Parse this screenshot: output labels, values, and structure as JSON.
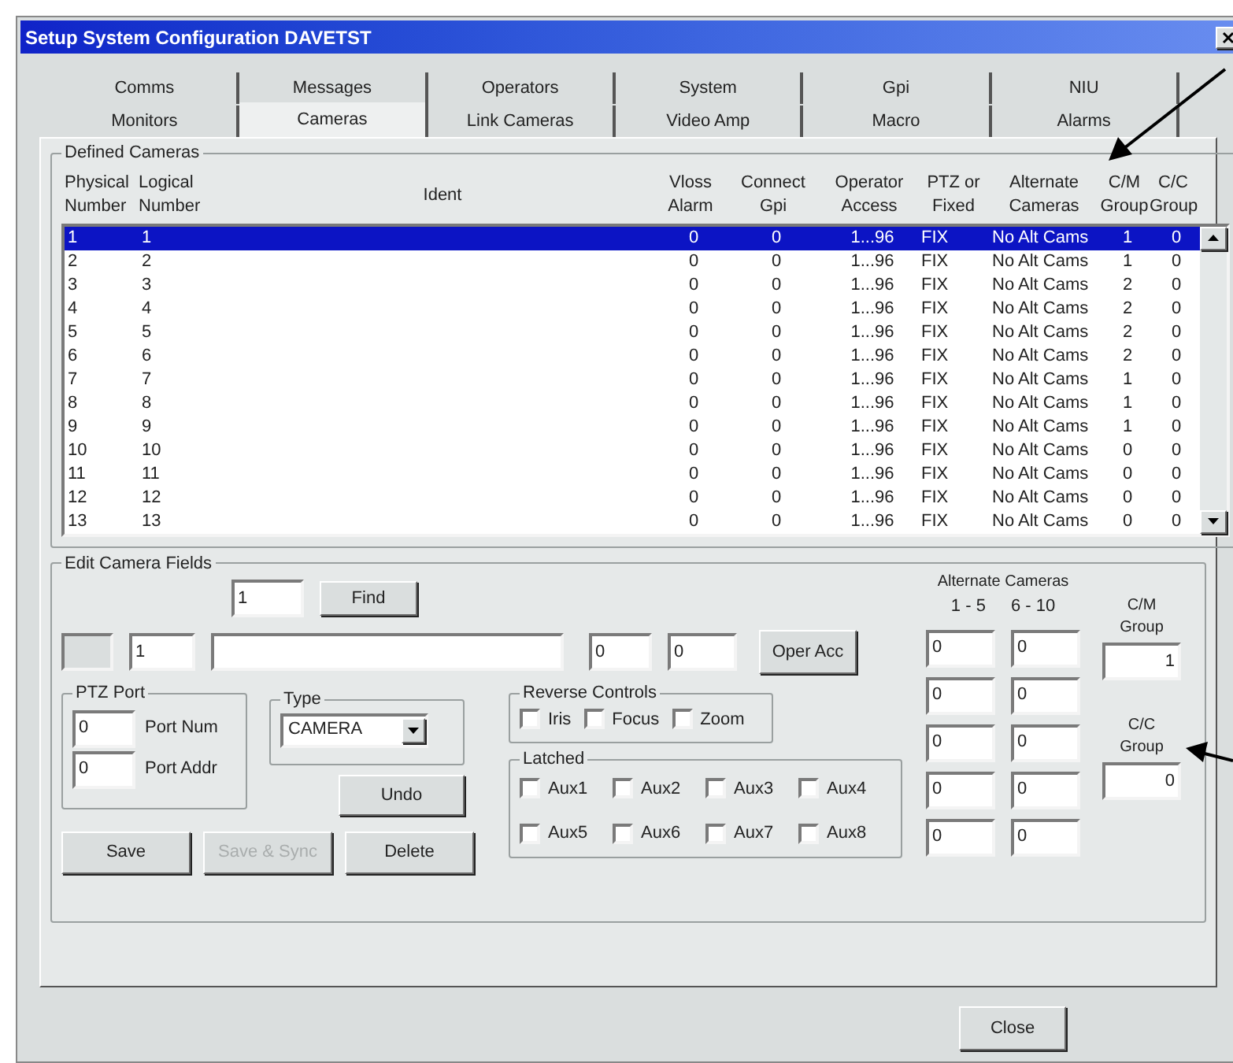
{
  "window": {
    "title": "Setup System Configuration  DAVETST"
  },
  "tabs": {
    "back_row": [
      {
        "label": "Comms",
        "selected": false
      },
      {
        "label": "Messages",
        "selected": false
      },
      {
        "label": "Operators",
        "selected": false
      },
      {
        "label": "System",
        "selected": false
      },
      {
        "label": "Gpi",
        "selected": false
      },
      {
        "label": "NIU",
        "selected": false
      }
    ],
    "front_row": [
      {
        "label": "Monitors",
        "selected": false
      },
      {
        "label": "Cameras",
        "selected": true
      },
      {
        "label": "Link Cameras",
        "selected": false
      },
      {
        "label": "Video Amp",
        "selected": false
      },
      {
        "label": "Macro",
        "selected": false
      },
      {
        "label": "Alarms",
        "selected": false
      }
    ]
  },
  "defined_cameras": {
    "title": "Defined Cameras",
    "columns": [
      {
        "lines": [
          "Physical",
          "Number"
        ]
      },
      {
        "lines": [
          "Logical",
          "Number"
        ]
      },
      {
        "lines": [
          "Ident"
        ]
      },
      {
        "lines": [
          "Vloss",
          "Alarm"
        ]
      },
      {
        "lines": [
          "Connect",
          "Gpi"
        ]
      },
      {
        "lines": [
          "Operator",
          "Access"
        ]
      },
      {
        "lines": [
          "PTZ or",
          "Fixed"
        ]
      },
      {
        "lines": [
          "Alternate",
          "Cameras"
        ]
      },
      {
        "lines": [
          "C/M",
          "Group"
        ]
      },
      {
        "lines": [
          "C/C",
          "Group"
        ]
      }
    ],
    "rows": [
      {
        "selected": true,
        "physical": "1",
        "logical": "1",
        "vloss_alarm": "0",
        "connect_gpi": "0",
        "operator_access": "1...96",
        "ptz_or_fixed": "FIX",
        "alternate_cameras": "No Alt Cams",
        "cm_group": "1",
        "cc_group": "0"
      },
      {
        "selected": false,
        "physical": "2",
        "logical": "2",
        "vloss_alarm": "0",
        "connect_gpi": "0",
        "operator_access": "1...96",
        "ptz_or_fixed": "FIX",
        "alternate_cameras": "No Alt Cams",
        "cm_group": "1",
        "cc_group": "0"
      },
      {
        "selected": false,
        "physical": "3",
        "logical": "3",
        "vloss_alarm": "0",
        "connect_gpi": "0",
        "operator_access": "1...96",
        "ptz_or_fixed": "FIX",
        "alternate_cameras": "No Alt Cams",
        "cm_group": "2",
        "cc_group": "0"
      },
      {
        "selected": false,
        "physical": "4",
        "logical": "4",
        "vloss_alarm": "0",
        "connect_gpi": "0",
        "operator_access": "1...96",
        "ptz_or_fixed": "FIX",
        "alternate_cameras": "No Alt Cams",
        "cm_group": "2",
        "cc_group": "0"
      },
      {
        "selected": false,
        "physical": "5",
        "logical": "5",
        "vloss_alarm": "0",
        "connect_gpi": "0",
        "operator_access": "1...96",
        "ptz_or_fixed": "FIX",
        "alternate_cameras": "No Alt Cams",
        "cm_group": "2",
        "cc_group": "0"
      },
      {
        "selected": false,
        "physical": "6",
        "logical": "6",
        "vloss_alarm": "0",
        "connect_gpi": "0",
        "operator_access": "1...96",
        "ptz_or_fixed": "FIX",
        "alternate_cameras": "No Alt Cams",
        "cm_group": "2",
        "cc_group": "0"
      },
      {
        "selected": false,
        "physical": "7",
        "logical": "7",
        "vloss_alarm": "0",
        "connect_gpi": "0",
        "operator_access": "1...96",
        "ptz_or_fixed": "FIX",
        "alternate_cameras": "No Alt Cams",
        "cm_group": "1",
        "cc_group": "0"
      },
      {
        "selected": false,
        "physical": "8",
        "logical": "8",
        "vloss_alarm": "0",
        "connect_gpi": "0",
        "operator_access": "1...96",
        "ptz_or_fixed": "FIX",
        "alternate_cameras": "No Alt Cams",
        "cm_group": "1",
        "cc_group": "0"
      },
      {
        "selected": false,
        "physical": "9",
        "logical": "9",
        "vloss_alarm": "0",
        "connect_gpi": "0",
        "operator_access": "1...96",
        "ptz_or_fixed": "FIX",
        "alternate_cameras": "No Alt Cams",
        "cm_group": "1",
        "cc_group": "0"
      },
      {
        "selected": false,
        "physical": "10",
        "logical": "10",
        "vloss_alarm": "0",
        "connect_gpi": "0",
        "operator_access": "1...96",
        "ptz_or_fixed": "FIX",
        "alternate_cameras": "No Alt Cams",
        "cm_group": "0",
        "cc_group": "0"
      },
      {
        "selected": false,
        "physical": "11",
        "logical": "11",
        "vloss_alarm": "0",
        "connect_gpi": "0",
        "operator_access": "1...96",
        "ptz_or_fixed": "FIX",
        "alternate_cameras": "No Alt Cams",
        "cm_group": "0",
        "cc_group": "0"
      },
      {
        "selected": false,
        "physical": "12",
        "logical": "12",
        "vloss_alarm": "0",
        "connect_gpi": "0",
        "operator_access": "1...96",
        "ptz_or_fixed": "FIX",
        "alternate_cameras": "No Alt Cams",
        "cm_group": "0",
        "cc_group": "0"
      },
      {
        "selected": false,
        "physical": "13",
        "logical": "13",
        "vloss_alarm": "0",
        "connect_gpi": "0",
        "operator_access": "1...96",
        "ptz_or_fixed": "FIX",
        "alternate_cameras": "No Alt Cams",
        "cm_group": "0",
        "cc_group": "0"
      }
    ]
  },
  "edit_camera_fields": {
    "title": "Edit Camera Fields",
    "find_value": "1",
    "find_button": {
      "label": "Find",
      "disabled": false
    },
    "physical_field": {
      "disabled": true
    },
    "logical_value": "1",
    "field_4": "0",
    "field_5": "0",
    "oper_acc_button": {
      "label": "Oper Acc",
      "disabled": false
    },
    "ptz_port": {
      "title": "PTZ Port",
      "fields": [
        {
          "value": "0",
          "label": "Port Num"
        },
        {
          "value": "0",
          "label": "Port Addr"
        }
      ]
    },
    "type": {
      "title": "Type",
      "value": "CAMERA"
    },
    "reverse_controls": {
      "title": "Reverse Controls",
      "options": [
        {
          "label": "Iris",
          "checked": false
        },
        {
          "label": "Focus",
          "checked": false
        },
        {
          "label": "Zoom",
          "checked": false
        }
      ]
    },
    "latched": {
      "title": "Latched",
      "options": [
        {
          "label": "Aux1",
          "checked": false
        },
        {
          "label": "Aux2",
          "checked": false
        },
        {
          "label": "Aux3",
          "checked": false
        },
        {
          "label": "Aux4",
          "checked": false
        },
        {
          "label": "Aux5",
          "checked": false
        },
        {
          "label": "Aux6",
          "checked": false
        },
        {
          "label": "Aux7",
          "checked": false
        },
        {
          "label": "Aux8",
          "checked": false
        }
      ]
    },
    "undo_button": {
      "label": "Undo",
      "disabled": false
    },
    "buttons": [
      {
        "label": "Save",
        "disabled": false
      },
      {
        "label": "Save & Sync",
        "disabled": true
      },
      {
        "label": "Delete",
        "disabled": false
      }
    ],
    "alternate_cameras": {
      "title": "Alternate Cameras",
      "column_headings": [
        "1 - 5",
        "6 - 10"
      ],
      "rows": [
        [
          "0",
          "0"
        ],
        [
          "0",
          "0"
        ],
        [
          "0",
          "0"
        ],
        [
          "0",
          "0"
        ],
        [
          "0",
          "0"
        ]
      ]
    },
    "cm_group": {
      "lines": [
        "C/M",
        "Group"
      ],
      "value": "1"
    },
    "cc_group": {
      "lines": [
        "C/C",
        "Group"
      ],
      "value": "0"
    }
  },
  "close_button": {
    "label": "Close",
    "disabled": false
  }
}
